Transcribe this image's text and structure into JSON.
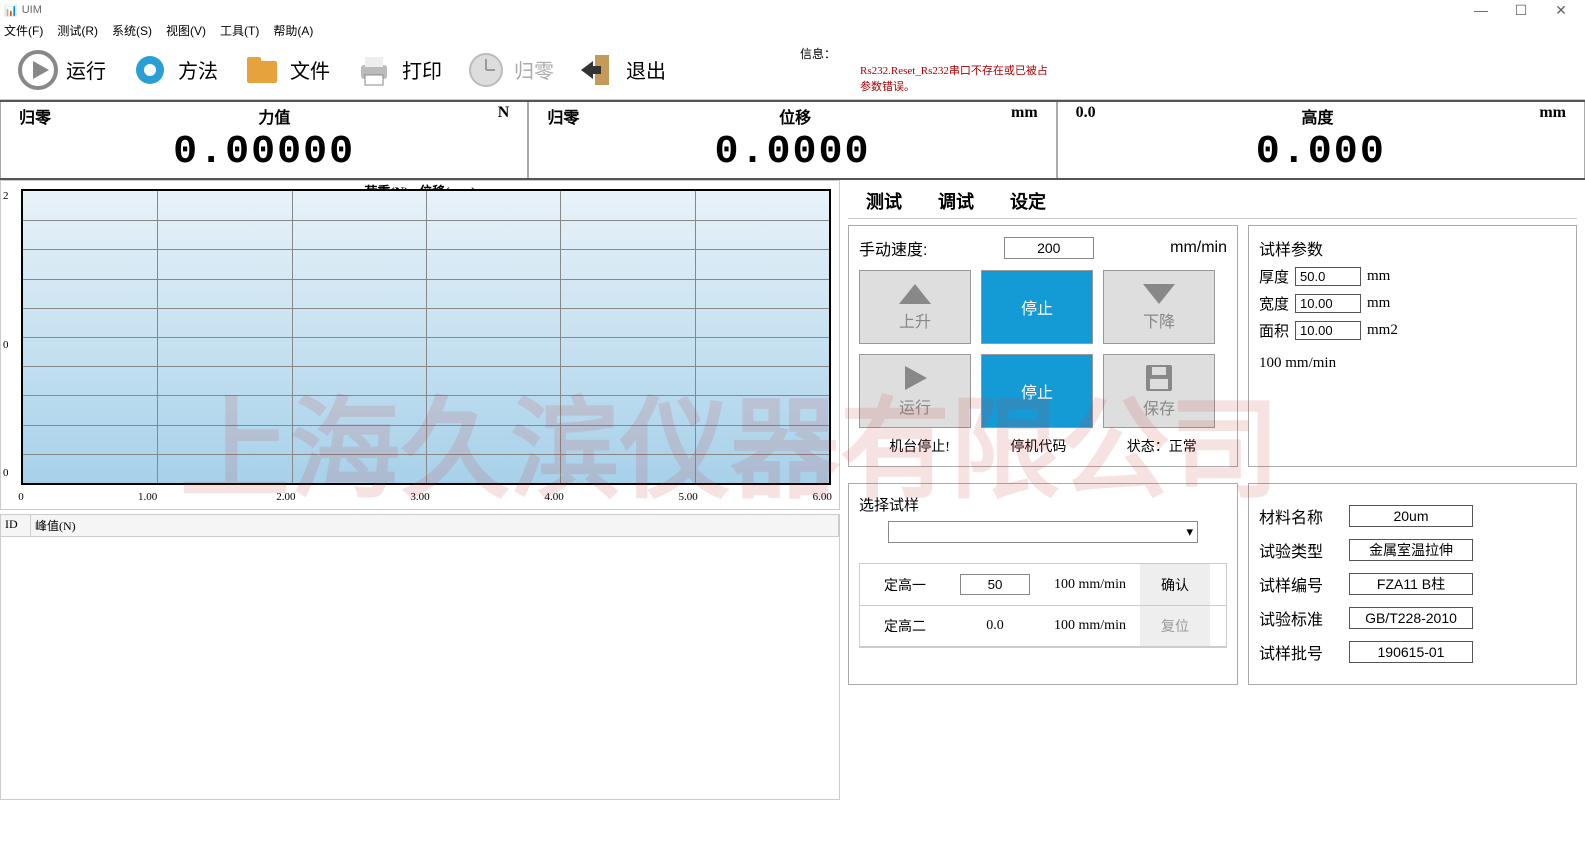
{
  "app_title": "UIM",
  "menu": {
    "file": "文件(F)",
    "test": "测试(R)",
    "system": "系统(S)",
    "view": "视图(V)",
    "tool": "工具(T)",
    "help": "帮助(A)"
  },
  "toolbar": {
    "run": "运行",
    "method": "方法",
    "file": "文件",
    "print": "打印",
    "zero": "归零",
    "exit": "退出"
  },
  "info": {
    "label": "信息：",
    "msg": "Rs232.Reset_Rs232串口不存在或已被占\n参数错误。"
  },
  "readouts": {
    "force": {
      "zero": "归零",
      "label": "力值",
      "unit": "N",
      "value": "0.00000"
    },
    "disp": {
      "zero": "归零",
      "label": "位移",
      "unit": "mm",
      "value": "0.0000"
    },
    "height": {
      "zero": "0.0",
      "label": "高度",
      "unit": "mm",
      "value": "0.000"
    }
  },
  "chart_data": {
    "type": "line",
    "title": "荷重(N) - 位移(mm)",
    "xlabel": "",
    "ylabel": "",
    "x_ticks": [
      "0",
      "1.00",
      "2.00",
      "3.00",
      "4.00",
      "5.00",
      "6.00"
    ],
    "y_ticks": [
      "0",
      "0",
      "2"
    ],
    "series": [
      {
        "name": "",
        "values": []
      }
    ],
    "xlim": [
      0,
      6
    ],
    "ylim": [
      0,
      2
    ]
  },
  "grid": {
    "cols": [
      "ID",
      "峰值(N)"
    ]
  },
  "tabs": {
    "test": "测试",
    "debug": "调试",
    "settings": "设定"
  },
  "manual": {
    "speed_label": "手动速度:",
    "speed_value": "200",
    "speed_unit": "mm/min",
    "up": "上升",
    "stop1": "停止",
    "down": "下降",
    "run": "运行",
    "stop2": "停止",
    "save": "保存",
    "machine_stop": "机台停止!",
    "stop_code": "停机代码",
    "state": "状态：正常"
  },
  "sample_params": {
    "title": "试样参数",
    "thickness_label": "厚度",
    "thickness": "50.0",
    "thickness_unit": "mm",
    "width_label": "宽度",
    "width": "10.00",
    "width_unit": "mm",
    "area_label": "面积",
    "area": "10.00",
    "area_unit": "mm2",
    "speed_note": "100 mm/min"
  },
  "select_sample": {
    "title": "选择试样"
  },
  "height_set": {
    "h1_label": "定高一",
    "h1_val": "50",
    "h1_spd": "100 mm/min",
    "confirm": "确认",
    "h2_label": "定高二",
    "h2_val": "0.0",
    "h2_spd": "100 mm/min",
    "reset": "复位"
  },
  "material_info": {
    "material_name_label": "材料名称",
    "material_name": "20um",
    "test_type_label": "试验类型",
    "test_type": "金属室温拉伸",
    "sample_id_label": "试样编号",
    "sample_id": "FZA11 B柱",
    "standard_label": "试验标准",
    "standard": "GB/T228-2010",
    "batch_label": "试样批号",
    "batch": "190615-01"
  }
}
